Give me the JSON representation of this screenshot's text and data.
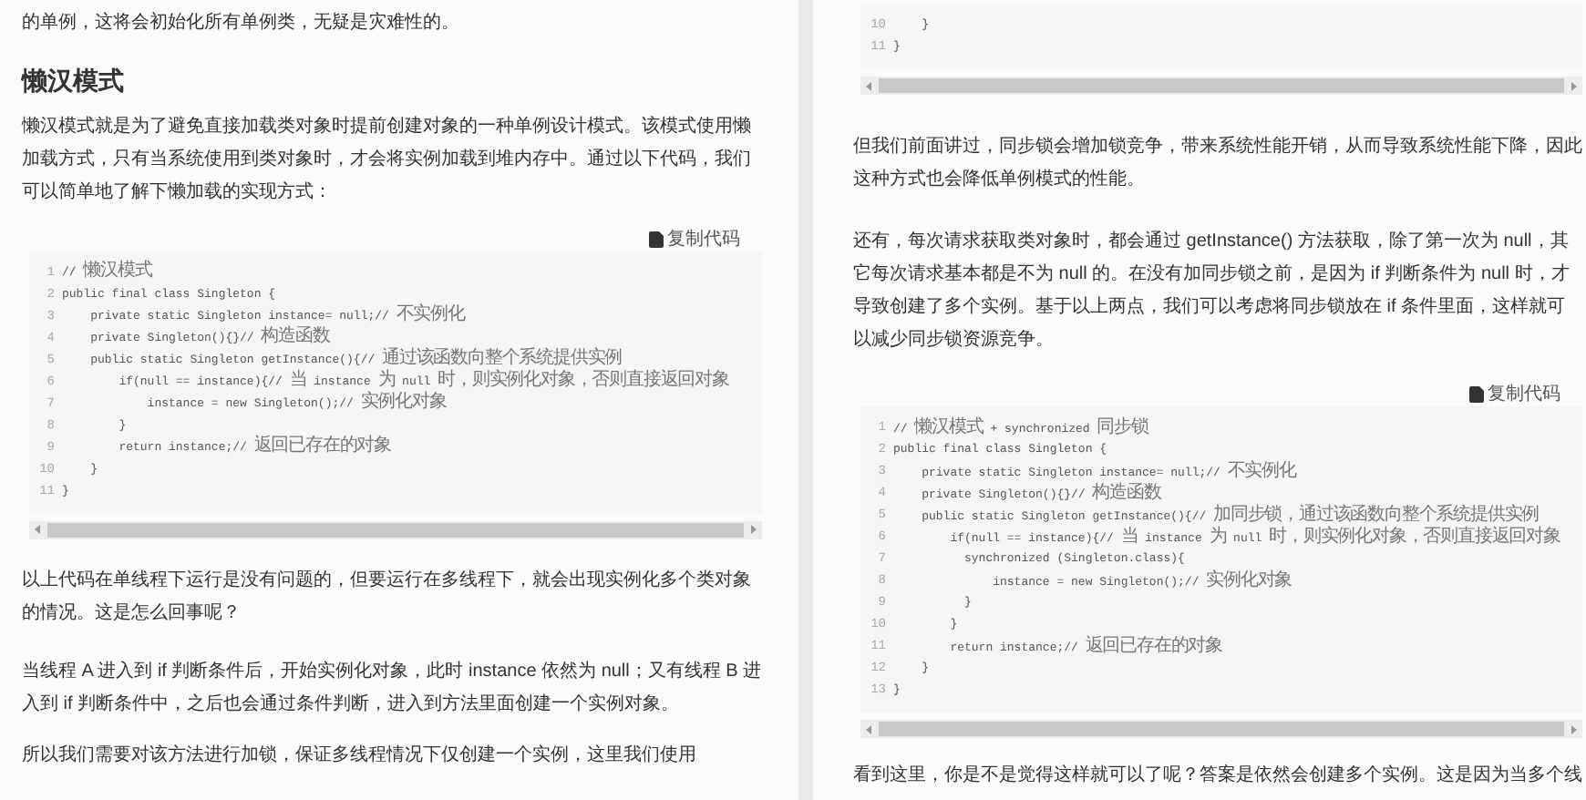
{
  "panes": [
    {
      "blocks": [
        {
          "kind": "paragraph",
          "text": "的单例，这将会初始化所有单例类，无疑是灾难性的。"
        },
        {
          "kind": "heading",
          "text": "懒汉模式"
        },
        {
          "kind": "paragraph",
          "text": "懒汉模式就是为了避免直接加载类对象时提前创建对象的一种单例设计模式。该模式使用懒加载方式，只有当系统使用到类对象时，才会将实例加载到堆内存中。通过以下代码，我们可以简单地了解下懒加载的实现方式："
        },
        {
          "kind": "code",
          "copy_label": "复制代码",
          "lines": [
            {
              "number": "1",
              "text": "// 懒汉模式"
            },
            {
              "number": "2",
              "text": "public final class Singleton {"
            },
            {
              "number": "3",
              "text": "    private static Singleton instance= null;// 不实例化"
            },
            {
              "number": "4",
              "text": "    private Singleton(){}// 构造函数"
            },
            {
              "number": "5",
              "text": "    public static Singleton getInstance(){// 通过该函数向整个系统提供实例"
            },
            {
              "number": "6",
              "text": "        if(null == instance){// 当 instance 为 null 时，则实例化对象，否则直接返回对象"
            },
            {
              "number": "7",
              "text": "            instance = new Singleton();// 实例化对象"
            },
            {
              "number": "8",
              "text": "        }"
            },
            {
              "number": "9",
              "text": "        return instance;// 返回已存在的对象"
            },
            {
              "number": "10",
              "text": "    }"
            },
            {
              "number": "11",
              "text": "}"
            }
          ]
        },
        {
          "kind": "paragraph",
          "text": "以上代码在单线程下运行是没有问题的，但要运行在多线程下，就会出现实例化多个类对象的情况。这是怎么回事呢？"
        },
        {
          "kind": "paragraph",
          "text": "当线程 A 进入到 if 判断条件后，开始实例化对象，此时 instance 依然为 null；又有线程 B 进入到 if 判断条件中，之后也会通过条件判断，进入到方法里面创建一个实例对象。"
        },
        {
          "kind": "paragraph",
          "text": "所以我们需要对该方法进行加锁，保证多线程情况下仅创建一个实例，这里我们使用"
        }
      ]
    },
    {
      "blocks": [
        {
          "kind": "code",
          "lines": [
            {
              "number": "10",
              "text": "    }"
            },
            {
              "number": "11",
              "text": "}"
            }
          ]
        },
        {
          "kind": "paragraph",
          "text": "但我们前面讲过，同步锁会增加锁竞争，带来系统性能开销，从而导致系统性能下降，因此这种方式也会降低单例模式的性能。"
        },
        {
          "kind": "paragraph",
          "text": "还有，每次请求获取类对象时，都会通过 getInstance() 方法获取，除了第一次为 null，其它每次请求基本都是不为 null 的。在没有加同步锁之前，是因为 if 判断条件为 null 时，才导致创建了多个实例。基于以上两点，我们可以考虑将同步锁放在 if 条件里面，这样就可以减少同步锁资源竞争。"
        },
        {
          "kind": "code",
          "copy_label": "复制代码",
          "lines": [
            {
              "number": "1",
              "text": "// 懒汉模式 + synchronized 同步锁"
            },
            {
              "number": "2",
              "text": "public final class Singleton {"
            },
            {
              "number": "3",
              "text": "    private static Singleton instance= null;// 不实例化"
            },
            {
              "number": "4",
              "text": "    private Singleton(){}// 构造函数"
            },
            {
              "number": "5",
              "text": "    public static Singleton getInstance(){// 加同步锁，通过该函数向整个系统提供实例"
            },
            {
              "number": "6",
              "text": "        if(null == instance){// 当 instance 为 null 时，则实例化对象，否则直接返回对象"
            },
            {
              "number": "7",
              "text": "          synchronized (Singleton.class){"
            },
            {
              "number": "8",
              "text": "              instance = new Singleton();// 实例化对象"
            },
            {
              "number": "9",
              "text": "          }"
            },
            {
              "number": "10",
              "text": "        }"
            },
            {
              "number": "11",
              "text": "        return instance;// 返回已存在的对象"
            },
            {
              "number": "12",
              "text": "    }"
            },
            {
              "number": "13",
              "text": "}"
            }
          ]
        },
        {
          "kind": "paragraph",
          "text": "看到这里，你是不是觉得这样就可以了呢？答案是依然会创建多个实例。这是因为当多个线"
        }
      ]
    }
  ]
}
